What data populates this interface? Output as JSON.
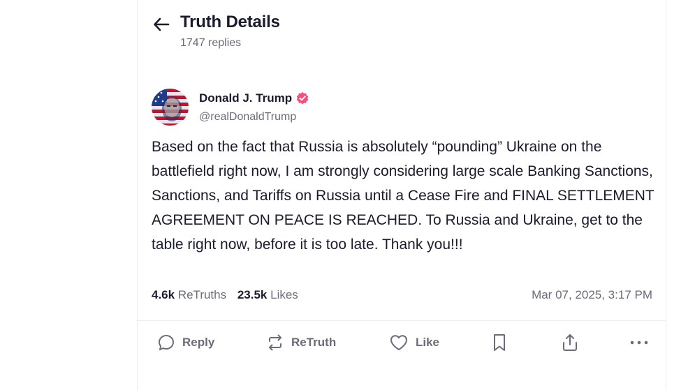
{
  "header": {
    "title": "Truth Details",
    "replies": "1747 replies"
  },
  "post": {
    "author_name": "Donald J. Trump",
    "handle": "@realDonaldTrump",
    "verified": true,
    "body": "Based on the fact that Russia is absolutely “pounding” Ukraine on the battlefield right now, I am strongly considering large scale Banking Sanctions, Sanctions, and Tariffs on Russia until a Cease Fire and FINAL SETTLEMENT AGREEMENT ON PEACE IS REACHED. To Russia and Ukraine, get to the table right now, before it is too late. Thank you!!!",
    "retruths_count": "4.6k",
    "retruths_label": "ReTruths",
    "likes_count": "23.5k",
    "likes_label": "Likes",
    "timestamp": "Mar 07, 2025, 3:17 PM"
  },
  "actions": {
    "reply_label": "Reply",
    "retruth_label": "ReTruth",
    "like_label": "Like"
  },
  "icons": {
    "back": "arrow-left-icon",
    "verified": "verified-badge-icon",
    "reply": "speech-bubble-icon",
    "retruth": "repost-arrows-icon",
    "like": "heart-icon",
    "bookmark": "bookmark-icon",
    "share": "share-icon",
    "more": "more-dots-icon"
  },
  "colors": {
    "verified_badge": "#f1517a",
    "text_primary": "#1b1b2e",
    "text_secondary": "#6b6b7b",
    "border": "#ececf1"
  }
}
